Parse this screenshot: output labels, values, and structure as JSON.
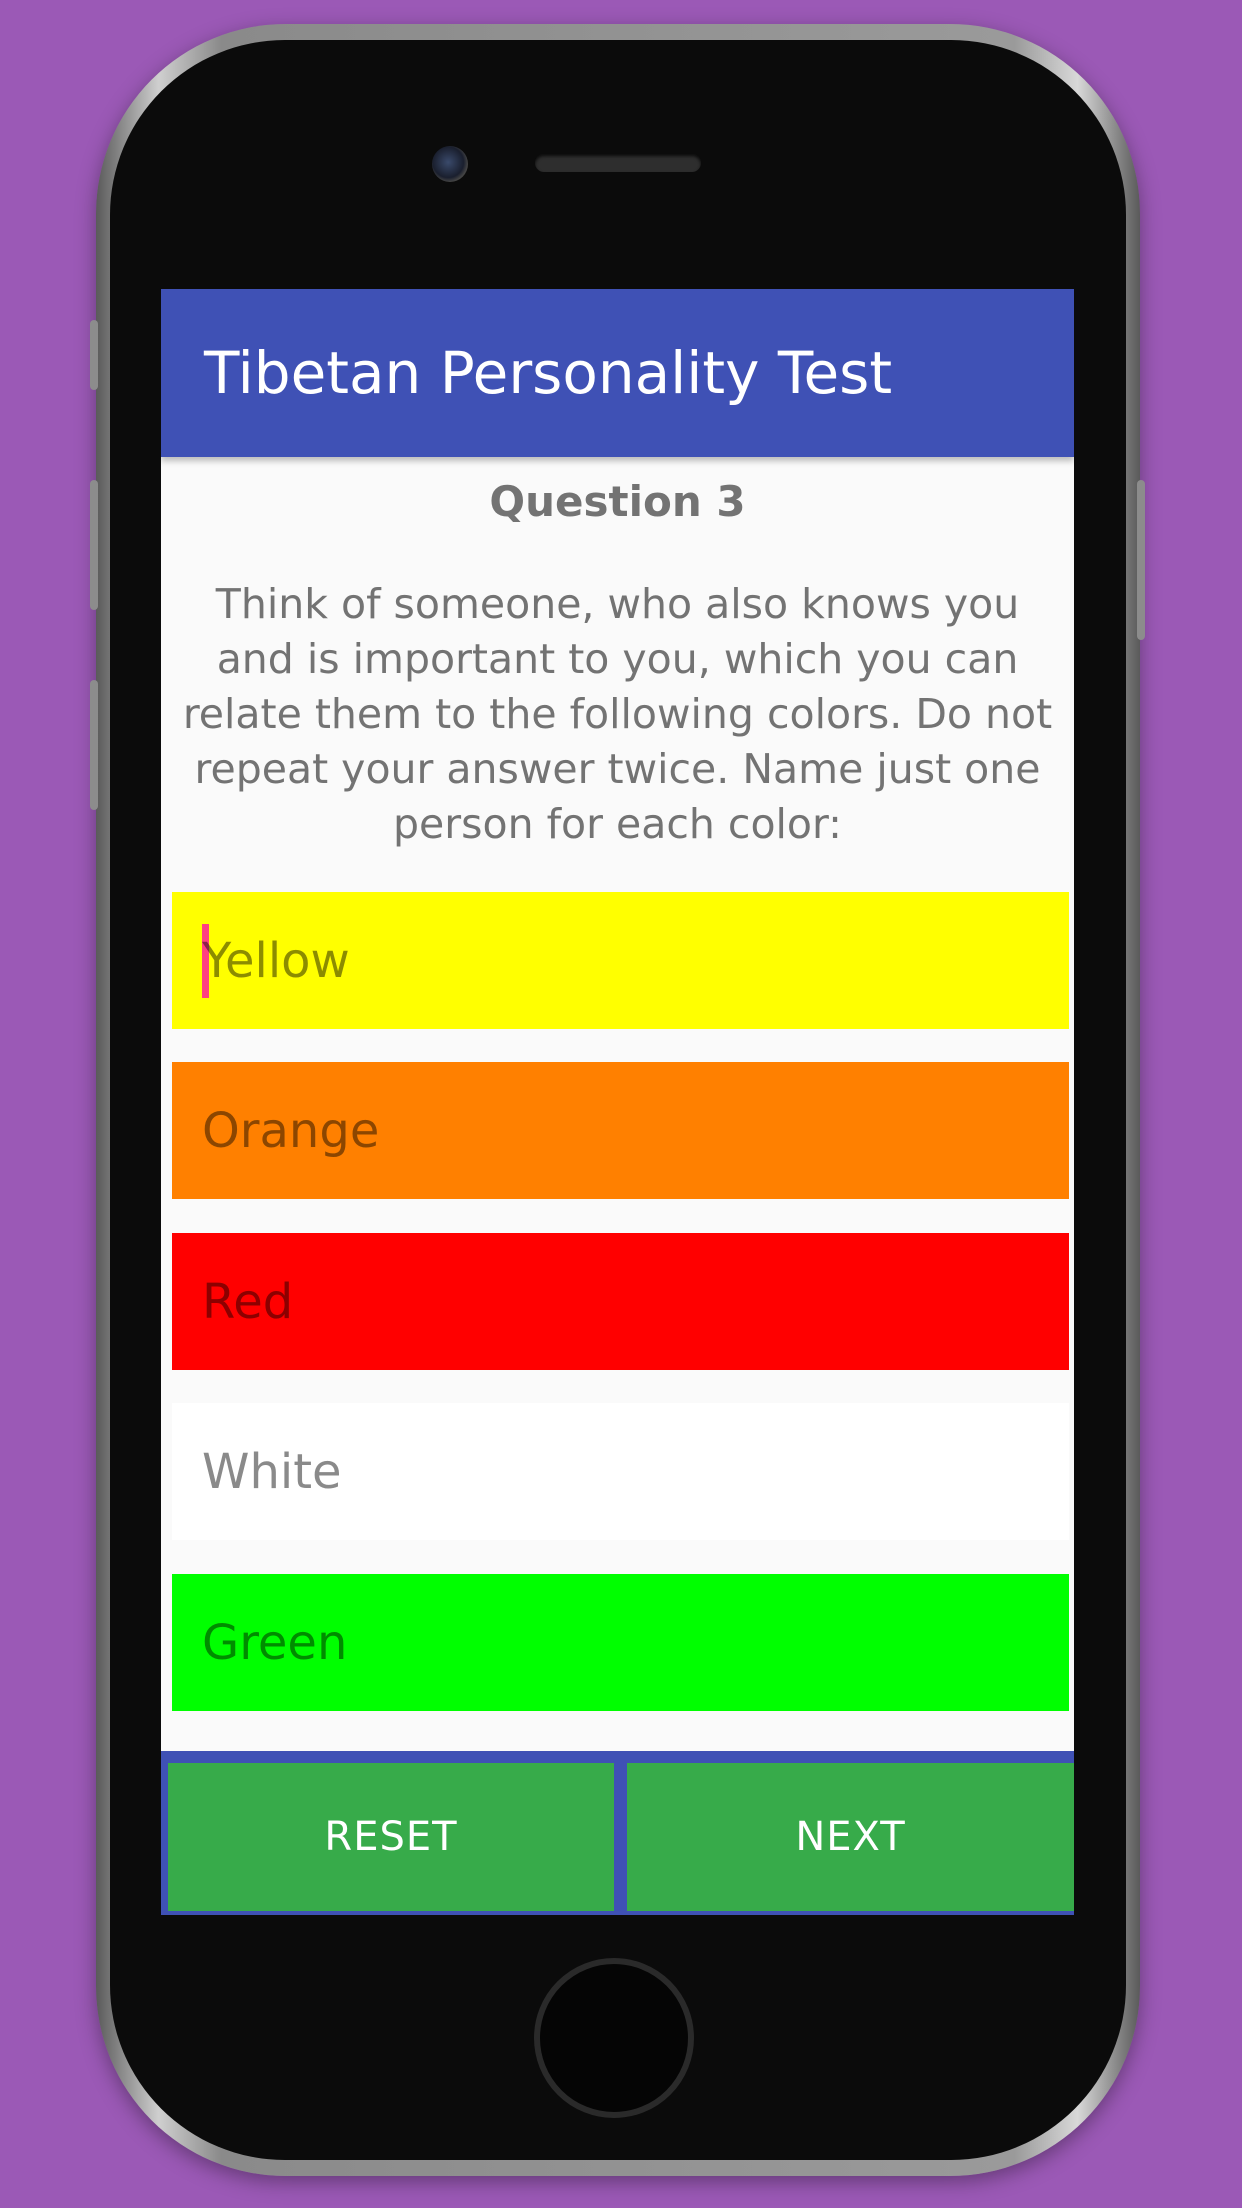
{
  "app": {
    "title": "Tibetan Personality Test"
  },
  "question": {
    "number_label": "Question 3",
    "text": "Think of someone, who also knows you and is important to you, which you can relate them to the following colors. Do not repeat your answer twice. Name just one person for each color:"
  },
  "fields": [
    {
      "placeholder": "Yellow",
      "color": "#ffff00",
      "focused": true
    },
    {
      "placeholder": "Orange",
      "color": "#ff8000",
      "focused": false
    },
    {
      "placeholder": "Red",
      "color": "#ff0000",
      "focused": false
    },
    {
      "placeholder": "White",
      "color": "#ffffff",
      "focused": false
    },
    {
      "placeholder": "Green",
      "color": "#00ff00",
      "focused": false
    }
  ],
  "buttons": {
    "reset_label": "RESET",
    "next_label": "NEXT"
  },
  "colors": {
    "background": "#9b59b6",
    "app_bar": "#3f51b5",
    "button": "#37ab4a",
    "cursor": "#ff4081"
  }
}
